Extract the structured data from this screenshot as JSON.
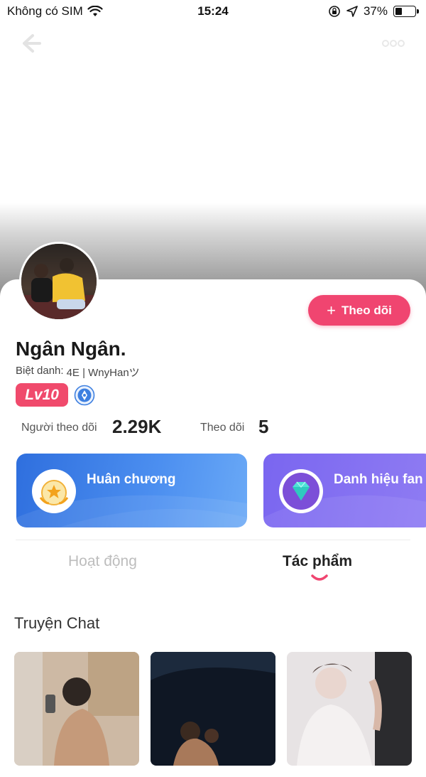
{
  "status_bar": {
    "carrier": "Không có SIM",
    "time": "15:24",
    "battery": "37%",
    "battery_level": 0.37
  },
  "header": {
    "back_icon": "arrow-left-icon",
    "more_icon": "more-dots-icon"
  },
  "profile": {
    "name": "Ngân Ngân.",
    "nickname_label": "Biệt danh:",
    "nickname_value": "4E | WnyHanツ",
    "level": "Lv10",
    "follow_button": "Theo dõi",
    "stats": {
      "followers_label": "Người theo dõi",
      "followers_value": "2.29K",
      "following_label": "Theo dõi",
      "following_value": "5"
    }
  },
  "tiles": [
    {
      "title": "Huân chương",
      "icon": "medal-icon",
      "color": "#3a7ee8"
    },
    {
      "title": "Danh hiệu fan",
      "icon": "diamond-icon",
      "color": "#8472f1"
    }
  ],
  "tabs": [
    {
      "label": "Hoạt động",
      "active": false
    },
    {
      "label": "Tác phẩm",
      "active": true
    }
  ],
  "section": {
    "title": "Truyện Chat"
  },
  "colors": {
    "accent": "#f04570",
    "level_badge": "#f04a6c"
  }
}
